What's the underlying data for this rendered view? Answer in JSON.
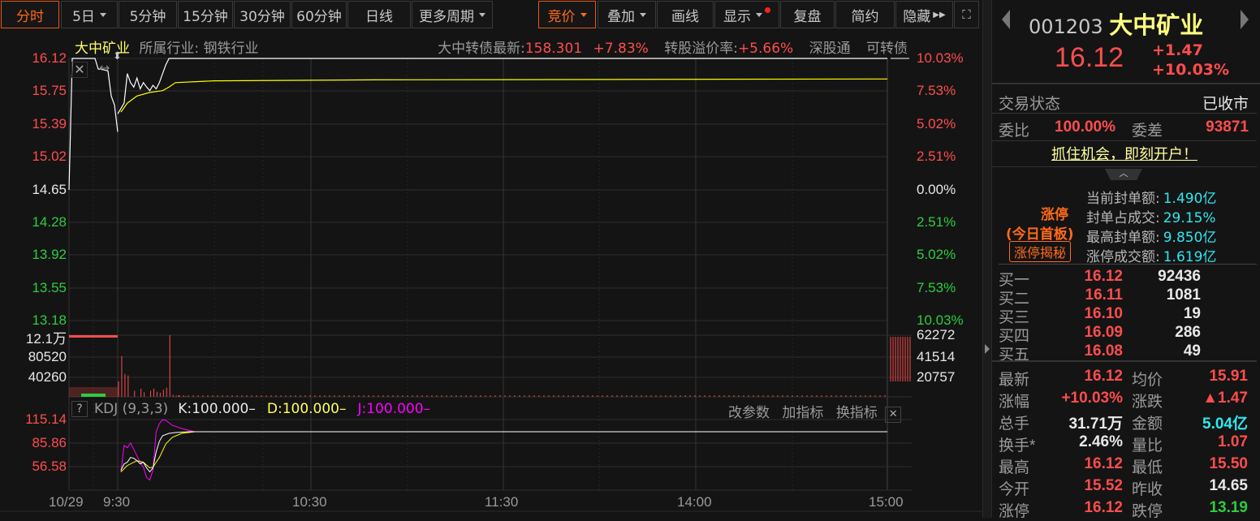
{
  "toolbar": {
    "tabs": [
      "分时",
      "5日",
      "5分钟",
      "15分钟",
      "30分钟",
      "60分钟",
      "日线",
      "更多周期"
    ],
    "right": [
      "竞价",
      "叠加",
      "画线",
      "显示",
      "复盘",
      "简约",
      "隐藏"
    ]
  },
  "info": {
    "name": "大中矿业",
    "industry": "所属行业: 钢铁行业",
    "bond_label": "大中转债最新:",
    "bond_price": "158.301",
    "bond_change": "+7.83%",
    "premium_label": "转股溢价率:",
    "premium": "+5.66%",
    "tag1": "深股通",
    "tag2": "可转债"
  },
  "price_axis": {
    "left": [
      "16.12",
      "15.75",
      "15.39",
      "15.02",
      "14.65",
      "14.28",
      "13.92",
      "13.55",
      "13.18"
    ],
    "right": [
      "10.03%",
      "7.53%",
      "5.02%",
      "2.51%",
      "0.00%",
      "2.51%",
      "5.02%",
      "7.53%",
      "10.03%"
    ]
  },
  "volume_axis": {
    "left": [
      "12.1万",
      "80520",
      "40260"
    ],
    "right": [
      "62272",
      "41514",
      "20757"
    ]
  },
  "kdj": {
    "help": "?",
    "name": "KDJ (9,3,3)",
    "k": "K:100.000–",
    "d": "D:100.000–",
    "j": "J:100.000–",
    "buttons": [
      "改参数",
      "加指标",
      "换指标"
    ],
    "axis": [
      "115.14",
      "85.86",
      "56.58"
    ]
  },
  "time_axis": [
    "10/29",
    "9:30",
    "10:30",
    "11:30",
    "14:00",
    "15:00"
  ],
  "colors": {
    "up": "#ff4d4d",
    "down": "#2ecc40",
    "price": "#ffffff",
    "avg": "#ffff00",
    "k": "#ffffff",
    "d": "#ffff00",
    "j": "#ff00ff"
  },
  "chart_data": {
    "type": "line",
    "prev_close": 14.65,
    "ylim": [
      13.18,
      16.12
    ],
    "price": [
      [
        0,
        15.5
      ],
      [
        2,
        15.62
      ],
      [
        3,
        15.95
      ],
      [
        4,
        15.85
      ],
      [
        5,
        15.8
      ],
      [
        6,
        15.9
      ],
      [
        7,
        15.78
      ],
      [
        8,
        15.85
      ],
      [
        9,
        15.8
      ],
      [
        10,
        15.76
      ],
      [
        11,
        15.82
      ],
      [
        12,
        15.78
      ],
      [
        13,
        15.85
      ],
      [
        14,
        15.95
      ],
      [
        15,
        16.05
      ],
      [
        16,
        16.12
      ],
      [
        240,
        16.12
      ]
    ],
    "auction_price": [
      [
        0,
        14.65
      ],
      [
        1,
        16.12
      ],
      [
        8,
        16.12
      ],
      [
        9,
        16.0
      ],
      [
        10,
        16.0
      ],
      [
        12,
        15.98
      ],
      [
        13,
        15.7
      ],
      [
        14,
        15.6
      ],
      [
        15,
        15.3
      ]
    ],
    "avg": [
      [
        1,
        15.52
      ],
      [
        3,
        15.62
      ],
      [
        6,
        15.7
      ],
      [
        10,
        15.74
      ],
      [
        14,
        15.76
      ],
      [
        16,
        15.8
      ],
      [
        18,
        15.85
      ],
      [
        30,
        15.87
      ],
      [
        80,
        15.88
      ],
      [
        240,
        15.89
      ]
    ],
    "volume": [
      [
        0,
        30000
      ],
      [
        1,
        80000
      ],
      [
        2,
        45000
      ],
      [
        3,
        42000
      ],
      [
        5,
        12000
      ],
      [
        7,
        16000
      ],
      [
        8,
        9000
      ],
      [
        10,
        12000
      ],
      [
        11,
        16000
      ],
      [
        12,
        10000
      ],
      [
        13,
        8000
      ],
      [
        14,
        14000
      ],
      [
        15,
        18000
      ],
      [
        16,
        121000
      ],
      [
        17,
        4000
      ],
      [
        18,
        2500
      ],
      [
        19,
        3000
      ],
      [
        21,
        1500
      ]
    ],
    "kdj_k": [
      [
        1,
        52
      ],
      [
        2,
        60
      ],
      [
        3,
        62
      ],
      [
        4,
        68
      ],
      [
        5,
        67
      ],
      [
        6,
        64
      ],
      [
        7,
        60
      ],
      [
        8,
        62
      ],
      [
        9,
        55
      ],
      [
        10,
        50
      ],
      [
        11,
        55
      ],
      [
        12,
        75
      ],
      [
        13,
        88
      ],
      [
        14,
        95
      ],
      [
        16,
        98
      ],
      [
        18,
        99
      ],
      [
        22,
        100
      ],
      [
        240,
        100
      ]
    ],
    "kdj_d": [
      [
        1,
        50
      ],
      [
        3,
        58
      ],
      [
        6,
        64
      ],
      [
        8,
        62
      ],
      [
        10,
        55
      ],
      [
        11,
        56
      ],
      [
        13,
        68
      ],
      [
        15,
        85
      ],
      [
        17,
        93
      ],
      [
        20,
        98
      ],
      [
        24,
        100
      ],
      [
        240,
        100
      ]
    ],
    "kdj_j": [
      [
        1,
        50
      ],
      [
        2,
        83
      ],
      [
        3,
        80
      ],
      [
        4,
        86
      ],
      [
        5,
        78
      ],
      [
        6,
        70
      ],
      [
        7,
        62
      ],
      [
        8,
        56
      ],
      [
        9,
        43
      ],
      [
        10,
        40
      ],
      [
        11,
        52
      ],
      [
        12,
        100
      ],
      [
        13,
        110
      ],
      [
        14,
        115
      ],
      [
        15,
        114
      ],
      [
        17,
        108
      ],
      [
        20,
        104
      ],
      [
        24,
        100
      ],
      [
        240,
        100
      ]
    ]
  },
  "quote": {
    "code": "001203",
    "name": "大中矿业",
    "price": "16.12",
    "change": "+1.47",
    "pct": "+10.03%",
    "status_label": "交易状态",
    "status": "已收市",
    "wb_label": "委比",
    "wb": "100.00%",
    "wc_label": "委差",
    "wc": "93871",
    "promo": "抓住机会，即刻开户！",
    "limit_title": "涨停",
    "limit_sub": "(今日首板)",
    "limit_btn": "涨停揭秘",
    "limit_rows": [
      [
        "当前封单额:",
        "1.490亿"
      ],
      [
        "封单占成交:",
        "29.15%"
      ],
      [
        "最高封单额:",
        "9.850亿"
      ],
      [
        "涨停成交额:",
        "1.619亿"
      ]
    ],
    "bids": [
      [
        "买一",
        "16.12",
        "92436"
      ],
      [
        "买二",
        "16.11",
        "1081"
      ],
      [
        "买三",
        "16.10",
        "19"
      ],
      [
        "买四",
        "16.09",
        "286"
      ],
      [
        "买五",
        "16.08",
        "49"
      ]
    ],
    "stats": [
      [
        "最新",
        "16.12",
        "均价",
        "15.91"
      ],
      [
        "涨幅",
        "+10.03%",
        "涨跌",
        "▲1.47"
      ],
      [
        "总手",
        "31.71万",
        "金额",
        "5.04亿"
      ],
      [
        "换手*",
        "2.46%",
        "量比",
        "1.07"
      ],
      [
        "最高",
        "16.12",
        "最低",
        "15.50"
      ],
      [
        "今开",
        "15.52",
        "昨收",
        "14.65"
      ],
      [
        "涨停",
        "16.12",
        "跌停",
        "13.19"
      ]
    ]
  }
}
